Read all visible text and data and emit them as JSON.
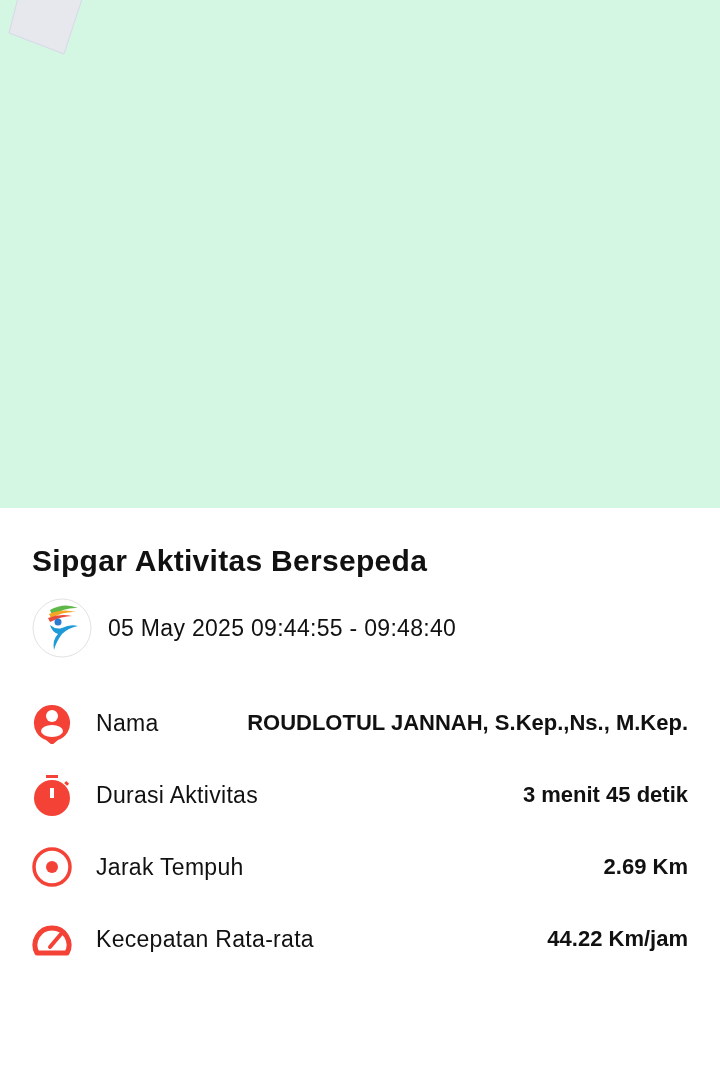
{
  "title": "Sipgar Aktivitas Bersepeda",
  "time_range": "05 May 2025 09:44:55 - 09:48:40",
  "stats": [
    {
      "kind": "person",
      "label": "Nama",
      "value": "ROUDLOTUL JANNAH, S.Kep.,Ns., M.Kep."
    },
    {
      "kind": "timer",
      "label": "Durasi Aktivitas",
      "value": "3 menit 45 detik"
    },
    {
      "kind": "target",
      "label": "Jarak Tempuh",
      "value": "2.69 Km"
    },
    {
      "kind": "gauge",
      "label": "Kecepatan Rata-rata",
      "value": "44.22 Km/jam"
    }
  ]
}
